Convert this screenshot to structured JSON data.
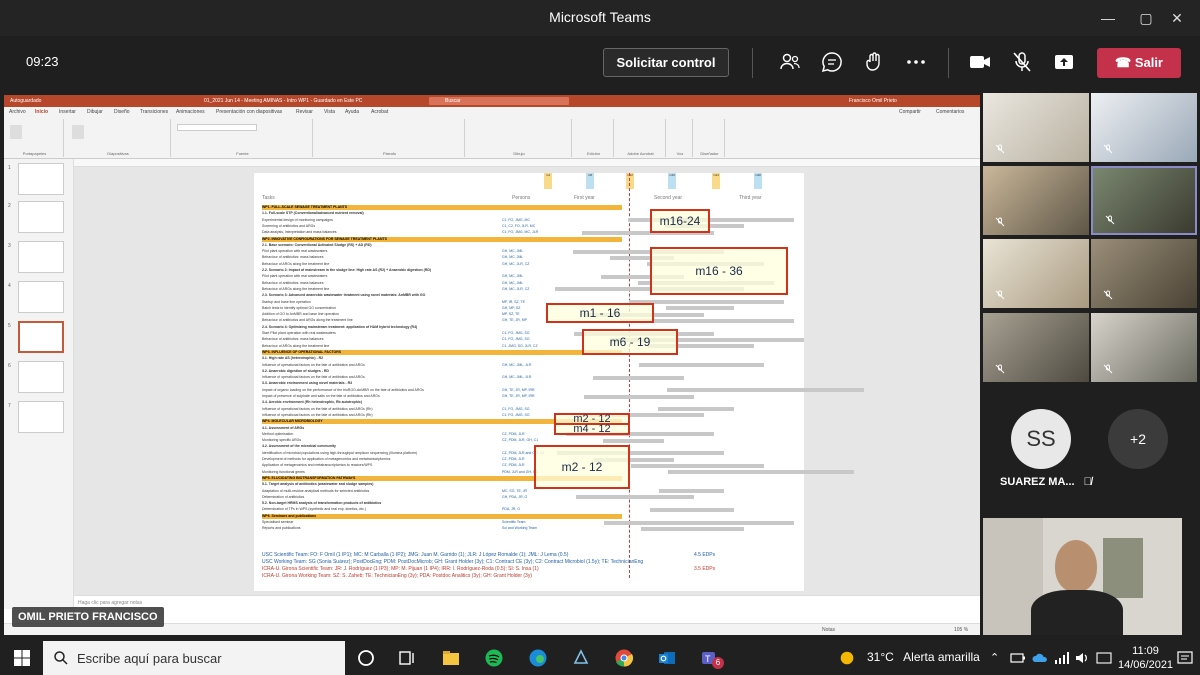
{
  "window": {
    "title": "Microsoft Teams",
    "minimize": "—",
    "maximize": "▢",
    "close": "✕"
  },
  "meeting": {
    "timer": "09:23",
    "request_control": "Solicitar control",
    "leave_label": "Salir",
    "leave_color": "#c4314b"
  },
  "presenter": {
    "name": "OMIL PRIETO FRANCISCO"
  },
  "powerpoint": {
    "autosave": "Autoguardado",
    "file_title": "01_2021 Jun 14 - Meeting AMINAS - Intro WP1 - Guardado en Este PC",
    "search_placeholder": "Buscar",
    "user": "Francisco Omil Prieto",
    "tabs": [
      "Archivo",
      "Inicio",
      "Insertar",
      "Dibujar",
      "Diseño",
      "Transiciones",
      "Animaciones",
      "Presentación con diapositivas",
      "Revisar",
      "Vista",
      "Ayuda",
      "Acrobat"
    ],
    "share": "Compartir",
    "comments": "Comentarios",
    "ribbon_groups": [
      "Portapapeles",
      "Diapositivas",
      "Fuente",
      "Párrafo",
      "Dibujo",
      "Edición",
      "Adobe Acrobat",
      "Voz",
      "Diseñador"
    ],
    "notes_placeholder": "Haga clic para agregar notas",
    "status": {
      "notes": "Notas",
      "zoom": "105 %"
    },
    "thumbnails": [
      "1",
      "2",
      "3",
      "4",
      "5",
      "6",
      "7"
    ],
    "accent": "#b7472a"
  },
  "slide": {
    "col_tasks": "Tasks",
    "col_persons": "Persons",
    "years": [
      "First year",
      "Second year",
      "Third year"
    ],
    "milestones": [
      "m4",
      "m8",
      "m12",
      "m16",
      "m24",
      "m30"
    ],
    "rows": [
      {
        "type": "wp",
        "text": "WP1. FULL-SCALE SEWAGE TREATMENT PLANTS"
      },
      {
        "type": "task",
        "text": "1.1. Full-scale STP (Conventional/advanced nutrient removal)"
      },
      {
        "type": "sub",
        "text": "Experimental design of monitoring campaigns",
        "persons": "C1, FO, JMG, MC"
      },
      {
        "type": "sub",
        "text": "Screening of antibiotics and ARGs",
        "persons": "C1, C2, FO, JLR, MC"
      },
      {
        "type": "sub",
        "text": "Data analysis, interpretation and mass balances",
        "persons": "C1, FO, JMG, MC, JLR"
      },
      {
        "type": "wp",
        "text": "WP2. INNOVATIVE CONFIGURATIONS FOR SEWAGE TREATMENT PLANTS"
      },
      {
        "type": "task",
        "text": "2.1. Base scenario: Conventional Activated Sludge (RS) + AD (RD)"
      },
      {
        "type": "sub",
        "text": "Pilot plant operation with real wastewaters",
        "persons": "GH, MC, JML"
      },
      {
        "type": "sub",
        "text": "Behaviour of antibiotics: mass balances",
        "persons": "GH, MC, JML"
      },
      {
        "type": "sub",
        "text": "Behaviour of ARGs along the treatment line",
        "persons": "GH, MC, JLR, CZ"
      },
      {
        "type": "task",
        "text": "2.2. Scenario 2: Impact of mainstream in the sludge line: High rate AS (R2) + Anaerobic digestion (RD)"
      },
      {
        "type": "sub",
        "text": "Pilot plant operation with real wastewaters",
        "persons": "GH, MC, JML"
      },
      {
        "type": "sub",
        "text": "Behaviour of antibiotics: mass balances",
        "persons": "GH, MC, JML"
      },
      {
        "type": "sub",
        "text": "Behaviour of ARGs along the treatment line",
        "persons": "GH, MC, JLR, CZ"
      },
      {
        "type": "task",
        "text": "2.3. Scenario 3: Advanced anaerobic wastewater treatment using novel materials: AnMBR with GO"
      },
      {
        "type": "sub",
        "text": "Startup and base line operation",
        "persons": "MP, IR, SZ, TE"
      },
      {
        "type": "sub",
        "text": "Batch tests to identify optimal GO concentration",
        "persons": "GH, MP, SZ"
      },
      {
        "type": "sub",
        "text": "Addition of GO to AnMBR and base line operation",
        "persons": "MP, SZ, TE"
      },
      {
        "type": "sub",
        "text": "Behaviour of antibiotics and ARGs along the treatment line",
        "persons": "GH, TE, JR, MP"
      },
      {
        "type": "task",
        "text": "2.4. Scenario 4: Optimizing mainstream treatment: application of HAM hybrid technology (R4)"
      },
      {
        "type": "sub",
        "text": "Start Pilot plant operation with real wastewaters",
        "persons": "C1, FO, JMG, SG"
      },
      {
        "type": "sub",
        "text": "Behaviour of antibiotics: mass balances",
        "persons": "C1, FO, JMG, SG"
      },
      {
        "type": "sub",
        "text": "Behaviour of ARGs along the treatment line",
        "persons": "C1, JMG, SG, JLR, CZ"
      },
      {
        "type": "wp",
        "text": "WP3. INFLUENCE OF OPERATIONAL FACTORS"
      },
      {
        "type": "task",
        "text": "3.1. High rate AS (heterotrophic) - R2"
      },
      {
        "type": "sub",
        "text": "Influence of operational factors on the fate of antibiotics and ARGs",
        "persons": "GH, MC, JML, JLR"
      },
      {
        "type": "task",
        "text": "3.2. Anaerobic digestion of sludges - RD"
      },
      {
        "type": "sub",
        "text": "Influence of operational factors on the fate of antibiotics and ARGs",
        "persons": "GH, MC, JML, JLR"
      },
      {
        "type": "task",
        "text": "3.3. Anaerobic environment using novel materials - R3"
      },
      {
        "type": "sub",
        "text": "Impact of organic loading on the performance of the bioRGO-AnMBR on the fate of antibiotics and ARGs",
        "persons": "GH, TE, JR, MP, IRR"
      },
      {
        "type": "sub",
        "text": "Impact of presence of sulphate and salts on the fate of antibiotics and ARGs",
        "persons": "GH, TE, JR, MP, IRR"
      },
      {
        "type": "task",
        "text": "3.4. Aerobic environment (Rh heterotrophic, Rb autotrophic)"
      },
      {
        "type": "sub",
        "text": "Influence of operational factors on the fate of antibiotics and ARGs (Rh)",
        "persons": "C1, FO, JMG, SG"
      },
      {
        "type": "sub",
        "text": "Influence of operational factors on the fate of antibiotics and ARGs (Rb)",
        "persons": "C1, FO, JMG, SG"
      },
      {
        "type": "wp",
        "text": "WP4. MOLECULAR MICROBIOLOGY"
      },
      {
        "type": "task",
        "text": "4.1. Assessment of ARGs"
      },
      {
        "type": "sub",
        "text": "Method optimisation",
        "persons": "CZ, PDM, JLR"
      },
      {
        "type": "sub",
        "text": "Monitoring specific ARGs",
        "persons": "CZ, PDM, JLR, GH, C1"
      },
      {
        "type": "task",
        "text": "4.2. Assessment of the microbial community"
      },
      {
        "type": "sub",
        "text": "Identification of microbial populations using high-throughput amplicon sequencing (Illumina platform)",
        "persons": "CZ, PDM, JLR and GH, C1"
      },
      {
        "type": "sub",
        "text": "Development of methods for application of metagenomics and metatranscriptomics",
        "persons": "CZ, PDM, JLR"
      },
      {
        "type": "sub",
        "text": "Application of metagenomics and metatranscriptomics to reactors/WPS",
        "persons": "CZ, PDM, JLR"
      },
      {
        "type": "sub",
        "text": "Monitoring functional genes",
        "persons": "PDM, JLR and GH, C1"
      },
      {
        "type": "wp",
        "text": "WP5. ELUCIDATING BIOTRANSFORMATION PATHWAYS"
      },
      {
        "type": "task",
        "text": "5.1. Target analysis of antibiotics (wastewater and sludge samples)"
      },
      {
        "type": "sub",
        "text": "Adaptation of multi-residue analytical methods for selected antibiotics",
        "persons": "MC, SG, TE, JR"
      },
      {
        "type": "sub",
        "text": "Determination of antibiotics",
        "persons": "GH, PDA, JR, G"
      },
      {
        "type": "task",
        "text": "5.2. Non-target HRMS analysis of transformation products of antibiotics"
      },
      {
        "type": "sub",
        "text": "Determination of TPs in WPS (synthetic and real exp. kinetics, etc.)",
        "persons": "PDA, JR, G"
      },
      {
        "type": "wp",
        "text": "WP6. Seminars and publications"
      },
      {
        "type": "sub",
        "text": "Specialised seminar",
        "persons": "Scientific Team"
      },
      {
        "type": "sub",
        "text": "Reports and publications",
        "persons": "Sci and Working Team"
      }
    ],
    "boxes": [
      "m16-24",
      "m16 - 36",
      "m1 - 16",
      "m6 - 19",
      "m2 - 12",
      "m4 - 12",
      "m2 - 12"
    ],
    "footnotes": [
      {
        "text": "USC Scientific Team: FO: F Omil (1 IP1); MC: M Carballa (1 IP2); JMG: Juan M. Garrido (1); JLR: J López Romalde (1); JML: J Lema (0.5)",
        "edps": "4.5 EDPs",
        "color": "#1f5fa8"
      },
      {
        "text": "USC Working Team: SG (Sonia Suárez); PostDocEng; PDM: PostDocMicrob; GH: Grant Holder (3y); C1: Contract CE (3y); C2: Contract Microbiol (1.5y); TE: TechnicianEng",
        "edps": "",
        "color": "#1f5fa8"
      },
      {
        "text": "ICRA-U. Girona Scientific Team: JR: J. Rodríguez (1 IP3); MP: M. Pijuan (1 IP4); IRR: I. Rodríguez-Roda (0.5); SI: S. Insa (1)",
        "edps": "3.5 EDPs",
        "color": "#c0392b"
      },
      {
        "text": "ICRA-U. Girona Working Team: SZ: S. Zaheb; TE: TechnicianEng (3y); PDA: Postdoc Analitics (3y); GH: Grant Holder (3y)",
        "edps": "",
        "color": "#c0392b"
      }
    ]
  },
  "participants": {
    "avatar_initials": "SS",
    "avatar_name": "SUAREZ MA...",
    "more_count": "+2"
  },
  "taskbar": {
    "search_placeholder": "Escribe aquí para buscar",
    "weather_temp": "31°C",
    "weather_alert": "Alerta amarilla",
    "time": "11:09",
    "date": "14/06/2021",
    "teams_badge": "6"
  }
}
